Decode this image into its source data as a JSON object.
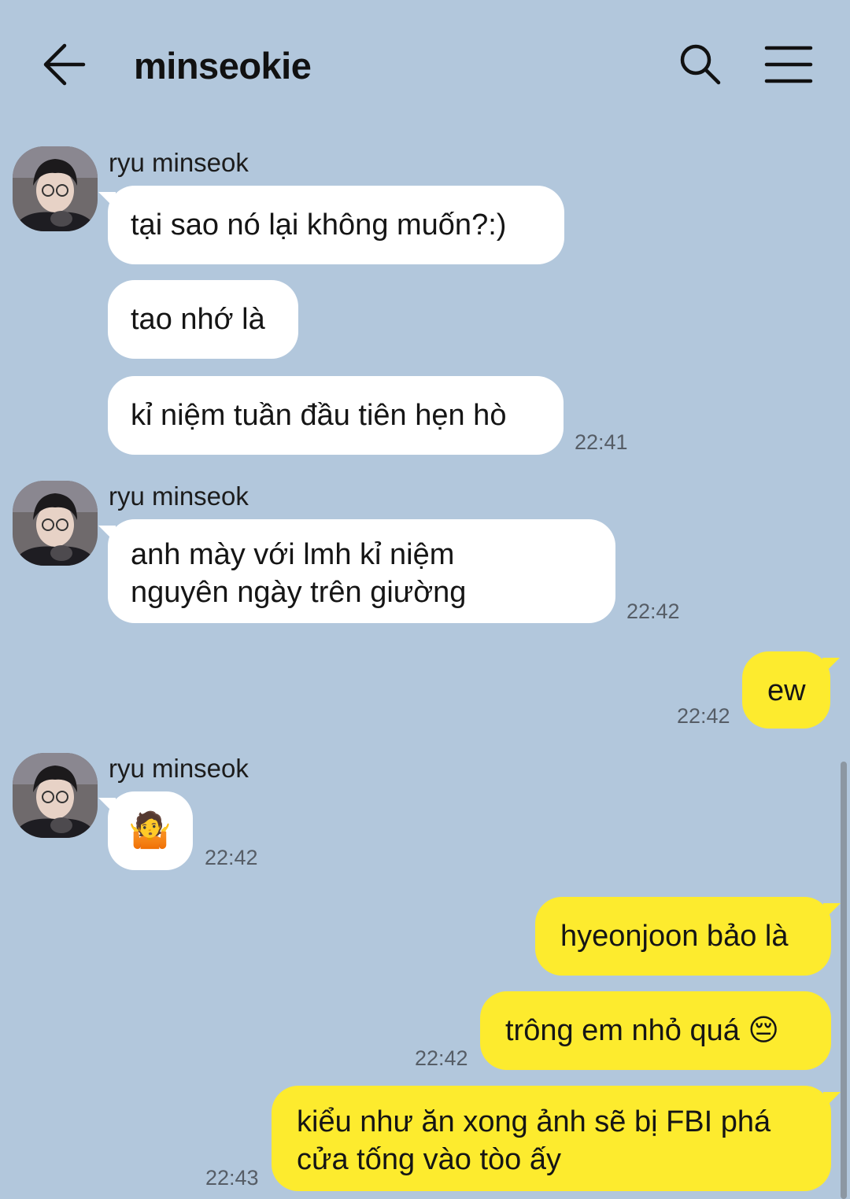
{
  "header": {
    "title": "minseokie",
    "back_icon": "arrow-left-icon",
    "search_icon": "search-icon",
    "menu_icon": "hamburger-menu-icon"
  },
  "colors": {
    "background": "#b2c7dc",
    "incoming_bubble": "#ffffff",
    "outgoing_bubble": "#fdeb2e"
  },
  "messages": {
    "g1": {
      "sender": "ryu minseok",
      "m1": "tại sao nó lại không muốn?:)",
      "m2": "tao nhớ là",
      "m3": "kỉ niệm tuần đầu tiên hẹn hò",
      "time": "22:41"
    },
    "g2": {
      "sender": "ryu minseok",
      "m1_line1": "anh mày với lmh kỉ niệm",
      "m1_line2": "nguyên ngày trên giường",
      "time": "22:42"
    },
    "g3": {
      "m1": "ew",
      "time": "22:42"
    },
    "g4": {
      "sender": "ryu minseok",
      "m1": "🤷",
      "time": "22:42"
    },
    "g5": {
      "m1": "hyeonjoon bảo là",
      "m2": "trông em nhỏ quá 😔",
      "time": "22:42"
    },
    "g6": {
      "m1_line1": "kiểu như ăn xong ảnh sẽ bị FBI phá",
      "m1_line2": "cửa tống vào tòo ấy",
      "time": "22:43"
    }
  }
}
